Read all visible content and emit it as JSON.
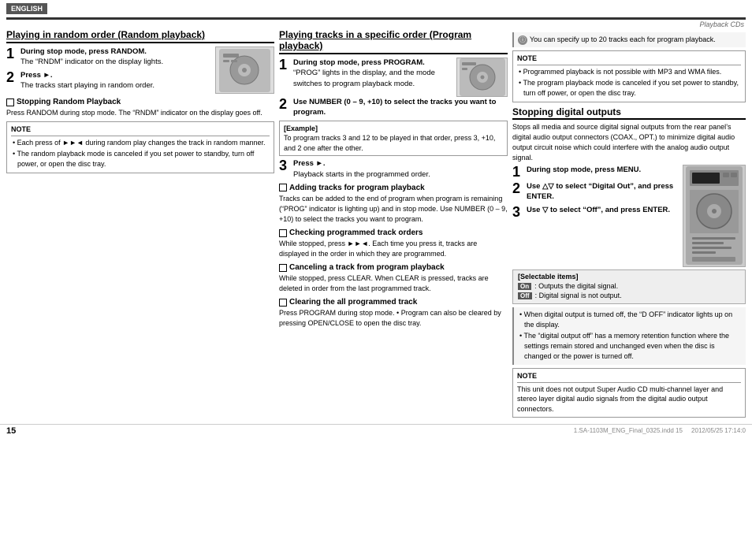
{
  "header": {
    "language_badge": "ENGLISH"
  },
  "playback_cds_label": "Playback CDs",
  "left_section": {
    "title": "Playing in random order (Random playback)",
    "step1_number": "1",
    "step1_heading": "During stop mode, press RANDOM.",
    "step1_body": "The “RNDM” indicator on the display lights.",
    "step2_number": "2",
    "step2_heading": "Press ►.",
    "step2_body": "The tracks start playing in random order.",
    "subsection_stopping": "Stopping Random Playback",
    "stopping_body": "Press RANDOM during stop mode. The “RNDM” indicator on the display goes off.",
    "note_label": "NOTE",
    "note_bullets": [
      "Each press of ►►◄ during random play changes the track in random manner.",
      "The random playback mode is canceled if you set power to standby, turn off power, or open the disc tray."
    ]
  },
  "middle_section": {
    "title": "Playing tracks in a specific order (Program playback)",
    "step1_number": "1",
    "step1_heading": "During stop mode, press PROGRAM.",
    "step1_body": "“PROG” lights in the display, and the mode switches to program playback mode.",
    "step2_number": "2",
    "step2_heading": "Use NUMBER (0 – 9, +10) to select the tracks you want to program.",
    "example_label": "[Example]",
    "example_body": "To program tracks 3 and 12 to be played in that order, press 3, +10, and 2 one after the other.",
    "step3_number": "3",
    "step3_heading": "Press ►.",
    "step3_body": "Playback starts in the programmed order.",
    "adding_title": "Adding tracks for program playback",
    "adding_body": "Tracks can be added to the end of program when program is remaining (“PROG” indicator is lighting up) and in stop mode.\nUse NUMBER (0 – 9, +10) to select the tracks you want to program.",
    "checking_title": "Checking programmed track orders",
    "checking_body": "While stopped, press ►►◄.\nEach time you press it, tracks are displayed in the order in which they are programmed.",
    "canceling_title": "Canceling a track from program playback",
    "canceling_body": "While stopped, press CLEAR.\nWhen CLEAR is pressed, tracks are deleted in order from the last programmed track.",
    "clearing_title": "Clearing the all programmed track",
    "clearing_body": "Press PROGRAM during stop mode.\n• Program can also be cleared by pressing OPEN/CLOSE to open the disc tray."
  },
  "right_section": {
    "info_top": "You can specify up to 20 tracks each for program playback.",
    "note_label": "NOTE",
    "note_bullets": [
      "Programmed playback is not possible with MP3 and WMA files.",
      "The program playback mode is canceled if you set power to standby, turn off power, or open the disc tray."
    ],
    "stopping_title": "Stopping digital outputs",
    "stopping_body": "Stops all media and source digital signal outputs from the rear panel’s digital audio output connectors (COAX., OPT.) to minimize digital audio output circuit noise which could interfere with the analog audio output signal.",
    "step1_number": "1",
    "step1_heading": "During stop mode, press MENU.",
    "step2_number": "2",
    "step2_heading": "Use △▽ to select “Digital Out”, and press ENTER.",
    "step3_number": "3",
    "step3_heading": "Use ▽ to select “Off”, and press ENTER.",
    "selectable_label": "[Selectable items]",
    "selectable_on_key": "On",
    "selectable_on_text": ": Outputs the digital signal.",
    "selectable_off_key": "Off",
    "selectable_off_text": ": Digital signal is not output.",
    "info_bottom_bullets": [
      "When digital output is turned off, the “D OFF” indicator lights up on the display.",
      "The “digital output off” has a memory retention function where the settings remain stored and unchanged even when the disc is changed or the power is turned off."
    ],
    "note_bottom_label": "NOTE",
    "note_bottom_text": "This unit does not output Super Audio CD multi-channel layer and stereo layer digital audio signals from the digital audio output connectors."
  },
  "footer": {
    "page_number": "15",
    "file_info": "1.SA-1103M_ENG_Final_0325.indd   15",
    "date_info": "2012/05/25   17:14:0"
  }
}
